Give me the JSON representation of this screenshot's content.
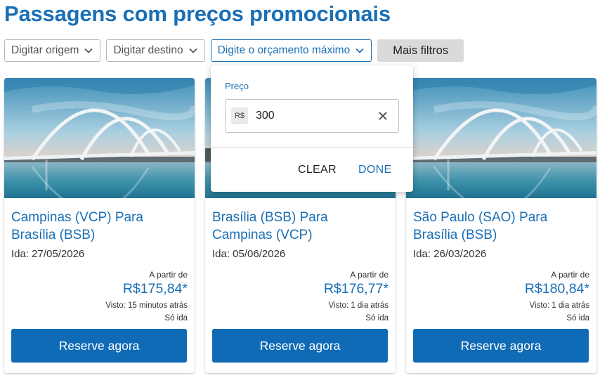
{
  "page_title": "Passagens com preços promocionais",
  "filters": {
    "origin": "Digitar origem",
    "destination": "Digitar destino",
    "budget": "Digite o orçamento máximo",
    "more": "Mais filtros"
  },
  "budget_dropdown": {
    "label": "Preço",
    "currency": "R$",
    "value": "300",
    "clear": "CLEAR",
    "done": "DONE"
  },
  "cards": [
    {
      "route": "Campinas (VCP) Para Brasília (BSB)",
      "date": "Ida: 27/05/2026",
      "from_label": "A partir de",
      "price": "R$175,84*",
      "seen": "Visto: 15 minutos atrás",
      "trip_type": "Só ida",
      "button": "Reserve agora"
    },
    {
      "route": "Brasília (BSB) Para Campinas (VCP)",
      "date": "Ida: 05/06/2026",
      "from_label": "A partir de",
      "price": "R$176,77*",
      "seen": "Visto: 1 dia atrás",
      "trip_type": "Só ida",
      "button": "Reserve agora"
    },
    {
      "route": "São Paulo (SAO) Para Brasília (BSB)",
      "date": "Ida: 26/03/2026",
      "from_label": "A partir de",
      "price": "R$180,84*",
      "seen": "Visto: 1 dia atrás",
      "trip_type": "Só ida",
      "button": "Reserve agora"
    }
  ],
  "colors": {
    "brand_blue": "#1a6fb5",
    "button_blue": "#0f6bb5",
    "chip_gray": "#dadada"
  },
  "icons": {
    "dropdown": "chevron-down-icon",
    "clear": "close-icon"
  }
}
